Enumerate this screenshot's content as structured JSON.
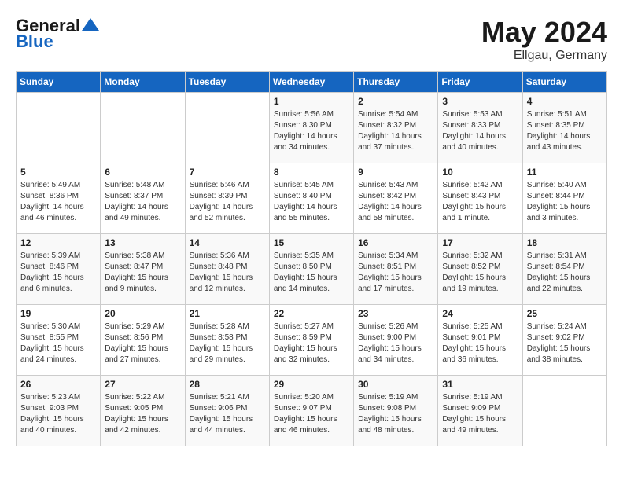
{
  "header": {
    "logo_general": "General",
    "logo_blue": "Blue",
    "month": "May 2024",
    "location": "Ellgau, Germany"
  },
  "days_of_week": [
    "Sunday",
    "Monday",
    "Tuesday",
    "Wednesday",
    "Thursday",
    "Friday",
    "Saturday"
  ],
  "weeks": [
    [
      {
        "day": "",
        "sunrise": "",
        "sunset": "",
        "daylight": ""
      },
      {
        "day": "",
        "sunrise": "",
        "sunset": "",
        "daylight": ""
      },
      {
        "day": "",
        "sunrise": "",
        "sunset": "",
        "daylight": ""
      },
      {
        "day": "1",
        "sunrise": "5:56 AM",
        "sunset": "8:30 PM",
        "daylight": "14 hours and 34 minutes."
      },
      {
        "day": "2",
        "sunrise": "5:54 AM",
        "sunset": "8:32 PM",
        "daylight": "14 hours and 37 minutes."
      },
      {
        "day": "3",
        "sunrise": "5:53 AM",
        "sunset": "8:33 PM",
        "daylight": "14 hours and 40 minutes."
      },
      {
        "day": "4",
        "sunrise": "5:51 AM",
        "sunset": "8:35 PM",
        "daylight": "14 hours and 43 minutes."
      }
    ],
    [
      {
        "day": "5",
        "sunrise": "5:49 AM",
        "sunset": "8:36 PM",
        "daylight": "14 hours and 46 minutes."
      },
      {
        "day": "6",
        "sunrise": "5:48 AM",
        "sunset": "8:37 PM",
        "daylight": "14 hours and 49 minutes."
      },
      {
        "day": "7",
        "sunrise": "5:46 AM",
        "sunset": "8:39 PM",
        "daylight": "14 hours and 52 minutes."
      },
      {
        "day": "8",
        "sunrise": "5:45 AM",
        "sunset": "8:40 PM",
        "daylight": "14 hours and 55 minutes."
      },
      {
        "day": "9",
        "sunrise": "5:43 AM",
        "sunset": "8:42 PM",
        "daylight": "14 hours and 58 minutes."
      },
      {
        "day": "10",
        "sunrise": "5:42 AM",
        "sunset": "8:43 PM",
        "daylight": "15 hours and 1 minute."
      },
      {
        "day": "11",
        "sunrise": "5:40 AM",
        "sunset": "8:44 PM",
        "daylight": "15 hours and 3 minutes."
      }
    ],
    [
      {
        "day": "12",
        "sunrise": "5:39 AM",
        "sunset": "8:46 PM",
        "daylight": "15 hours and 6 minutes."
      },
      {
        "day": "13",
        "sunrise": "5:38 AM",
        "sunset": "8:47 PM",
        "daylight": "15 hours and 9 minutes."
      },
      {
        "day": "14",
        "sunrise": "5:36 AM",
        "sunset": "8:48 PM",
        "daylight": "15 hours and 12 minutes."
      },
      {
        "day": "15",
        "sunrise": "5:35 AM",
        "sunset": "8:50 PM",
        "daylight": "15 hours and 14 minutes."
      },
      {
        "day": "16",
        "sunrise": "5:34 AM",
        "sunset": "8:51 PM",
        "daylight": "15 hours and 17 minutes."
      },
      {
        "day": "17",
        "sunrise": "5:32 AM",
        "sunset": "8:52 PM",
        "daylight": "15 hours and 19 minutes."
      },
      {
        "day": "18",
        "sunrise": "5:31 AM",
        "sunset": "8:54 PM",
        "daylight": "15 hours and 22 minutes."
      }
    ],
    [
      {
        "day": "19",
        "sunrise": "5:30 AM",
        "sunset": "8:55 PM",
        "daylight": "15 hours and 24 minutes."
      },
      {
        "day": "20",
        "sunrise": "5:29 AM",
        "sunset": "8:56 PM",
        "daylight": "15 hours and 27 minutes."
      },
      {
        "day": "21",
        "sunrise": "5:28 AM",
        "sunset": "8:58 PM",
        "daylight": "15 hours and 29 minutes."
      },
      {
        "day": "22",
        "sunrise": "5:27 AM",
        "sunset": "8:59 PM",
        "daylight": "15 hours and 32 minutes."
      },
      {
        "day": "23",
        "sunrise": "5:26 AM",
        "sunset": "9:00 PM",
        "daylight": "15 hours and 34 minutes."
      },
      {
        "day": "24",
        "sunrise": "5:25 AM",
        "sunset": "9:01 PM",
        "daylight": "15 hours and 36 minutes."
      },
      {
        "day": "25",
        "sunrise": "5:24 AM",
        "sunset": "9:02 PM",
        "daylight": "15 hours and 38 minutes."
      }
    ],
    [
      {
        "day": "26",
        "sunrise": "5:23 AM",
        "sunset": "9:03 PM",
        "daylight": "15 hours and 40 minutes."
      },
      {
        "day": "27",
        "sunrise": "5:22 AM",
        "sunset": "9:05 PM",
        "daylight": "15 hours and 42 minutes."
      },
      {
        "day": "28",
        "sunrise": "5:21 AM",
        "sunset": "9:06 PM",
        "daylight": "15 hours and 44 minutes."
      },
      {
        "day": "29",
        "sunrise": "5:20 AM",
        "sunset": "9:07 PM",
        "daylight": "15 hours and 46 minutes."
      },
      {
        "day": "30",
        "sunrise": "5:19 AM",
        "sunset": "9:08 PM",
        "daylight": "15 hours and 48 minutes."
      },
      {
        "day": "31",
        "sunrise": "5:19 AM",
        "sunset": "9:09 PM",
        "daylight": "15 hours and 49 minutes."
      },
      {
        "day": "",
        "sunrise": "",
        "sunset": "",
        "daylight": ""
      }
    ]
  ]
}
